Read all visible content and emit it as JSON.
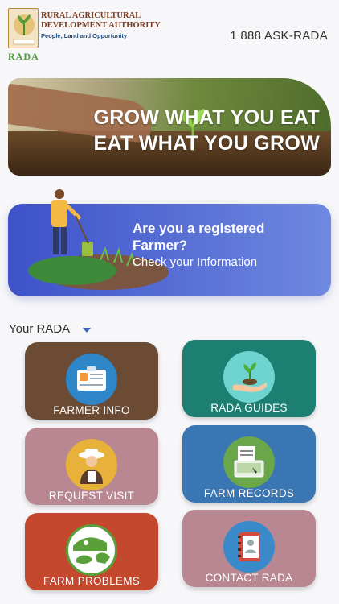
{
  "header": {
    "org_name": "RURAL AGRICULTURAL DEVELOPMENT AUTHORITY",
    "tagline": "People, Land and Opportunity",
    "logo_text": "RADA",
    "phone": "1 888 ASK-RADA"
  },
  "hero": {
    "line1": "GROW WHAT YOU EAT",
    "line2": "EAT WHAT YOU GROW"
  },
  "register": {
    "title": "Are you a registered Farmer?",
    "subtitle": "Check your Information"
  },
  "section": {
    "title": "Your RADA"
  },
  "tiles": [
    {
      "label": "FARMER INFO",
      "color": "#6b4b34",
      "icon": "id-card-icon"
    },
    {
      "label": "RADA GUIDES",
      "color": "#1d7e72",
      "icon": "hand-plant-icon"
    },
    {
      "label": "REQUEST VISIT",
      "color": "#b98791",
      "icon": "farmer-icon"
    },
    {
      "label": "FARM RECORDS",
      "color": "#3a76b3",
      "icon": "records-icon"
    },
    {
      "label": "FARM PROBLEMS",
      "color": "#c4482e",
      "icon": "problems-icon"
    },
    {
      "label": "CONTACT RADA",
      "color": "#b98791",
      "icon": "contact-book-icon"
    }
  ]
}
